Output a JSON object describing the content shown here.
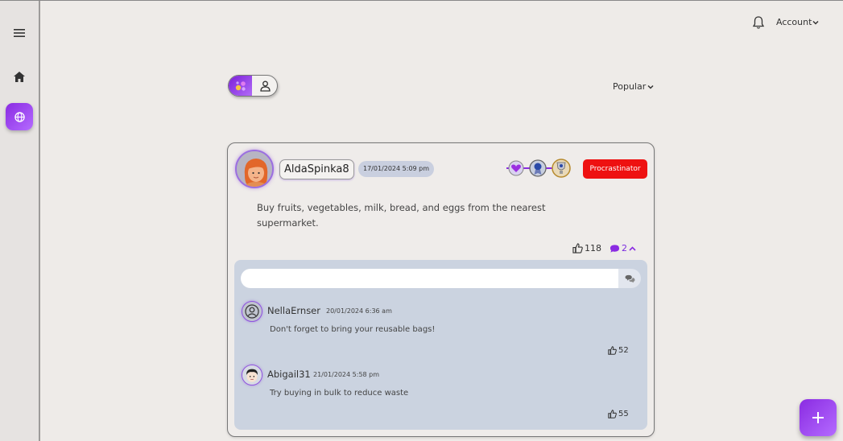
{
  "header": {
    "account_label": "Account"
  },
  "feed": {
    "sort_label": "Popular"
  },
  "post": {
    "username": "AldaSpinka8",
    "date": "17/01/2024 5:09 pm",
    "badge_label": "Procrastinator",
    "text": "Buy fruits, vegetables, milk, bread, and eggs from the nearest supermarket.",
    "likes": "118",
    "comments_count": "2"
  },
  "comment_box": {
    "value": "",
    "placeholder": ""
  },
  "comments": [
    {
      "username": "NellaErnser",
      "date": "20/01/2024 6:36 am",
      "text": "Don't forget to bring your reusable bags!",
      "likes": "52",
      "avatar": "user-outline-icon"
    },
    {
      "username": "Abigail31",
      "date": "21/01/2024 5:58 pm",
      "text": "Try buying in bulk to reduce waste",
      "likes": "55",
      "avatar": "cartoon-avatar"
    }
  ],
  "colors": {
    "accent": "#8a2be2",
    "badge_red": "#ee1111",
    "comments_bg": "#cbd3e0"
  }
}
